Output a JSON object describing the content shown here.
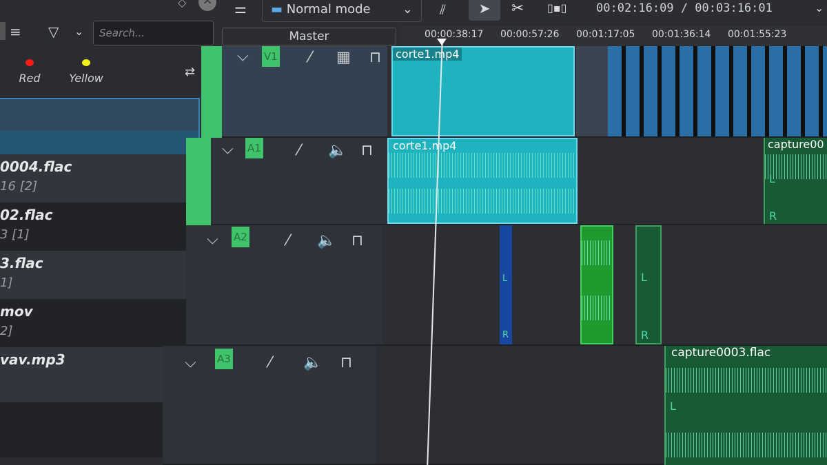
{
  "bin": {
    "search_placeholder": "Search...",
    "tags": [
      {
        "label": "Red",
        "color": "#ff1a1a"
      },
      {
        "label": "Yellow",
        "color": "#f2f21a"
      }
    ],
    "items": [
      {
        "name": "",
        "sub": ""
      },
      {
        "name": "",
        "sub": ""
      },
      {
        "name": "0004.flac",
        "sub": "16 [2]"
      },
      {
        "name": "02.flac",
        "sub": "3 [1]"
      },
      {
        "name": "3.flac",
        "sub": "1]"
      },
      {
        "name": "mov",
        "sub": "2]"
      },
      {
        "name": "vav.mp3",
        "sub": ""
      }
    ]
  },
  "toolbar": {
    "mode": "Normal mode",
    "timecode": "00:02:16:09 / 00:03:16:01"
  },
  "ruler": {
    "master": "Master",
    "ticks": [
      "00:00:38:17",
      "00:00:57:26",
      "00:01:17:05",
      "00:01:36:14",
      "00:01:55:23"
    ]
  },
  "tracks": [
    {
      "label": "V1"
    },
    {
      "label": "A1"
    },
    {
      "label": "A2"
    },
    {
      "label": "A3"
    }
  ],
  "clips": {
    "v1": "corte1.mp4",
    "a1": "corte1.mp4",
    "a1b": "capture00",
    "a3": "capture0003.flac",
    "channel_l": "L",
    "channel_r": "R"
  },
  "colors": {
    "track_active": "#3fc46b",
    "selected_clip": "#1fb3bf",
    "audio_clip": "#175a33"
  }
}
